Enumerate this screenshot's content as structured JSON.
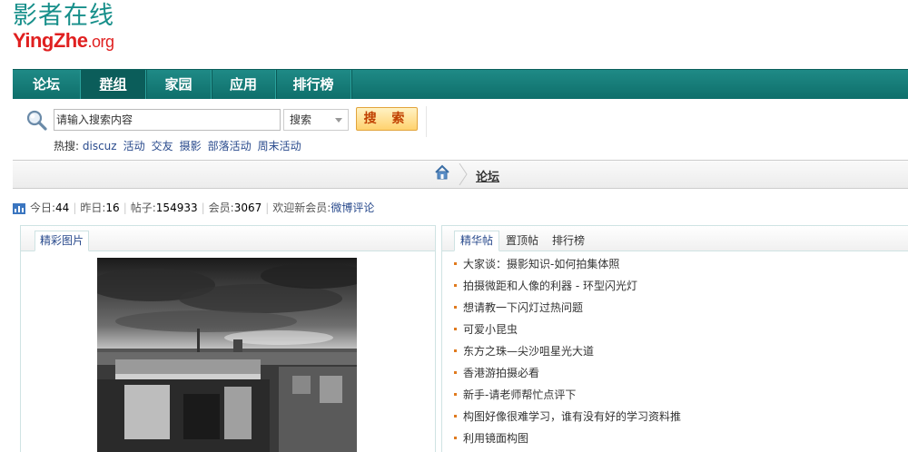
{
  "logo": {
    "cn": "影者在线",
    "en": "YingZhe",
    "en_suffix": ".org"
  },
  "nav": {
    "items": [
      "论坛",
      "群组",
      "家园",
      "应用",
      "排行榜"
    ],
    "active_index": 1
  },
  "search": {
    "placeholder": "请输入搜索内容",
    "type_selected": "搜索",
    "button_label": "搜 索",
    "hot_label": "热搜:",
    "hot_terms": [
      "discuz",
      "活动",
      "交友",
      "摄影",
      "部落活动",
      "周末活动"
    ]
  },
  "breadcrumb": {
    "current": "论坛"
  },
  "stats": {
    "today_label": "今日:",
    "today_value": "44",
    "yesterday_label": "昨日:",
    "yesterday_value": "16",
    "posts_label": "帖子:",
    "posts_value": "154933",
    "members_label": "会员:",
    "members_value": "3067",
    "welcome_label": "欢迎新会员:",
    "new_member": "微博评论"
  },
  "left_panel": {
    "tab": "精彩图片"
  },
  "right_panel": {
    "tabs": [
      "精华帖",
      "置顶帖",
      "排行榜"
    ],
    "active_tab": 0,
    "threads": [
      "大家谈：摄影知识-如何拍集体照",
      "拍摄微距和人像的利器 - 环型闪光灯",
      "想请教一下闪灯过热问题",
      "可爱小昆虫",
      "东方之珠—尖沙咀星光大道",
      "香港游拍摄必看",
      "新手-请老师帮忙点评下",
      "构图好像很难学习，谁有没有好的学习资料推",
      "利用镜面构图"
    ]
  },
  "colors": {
    "brand_teal": "#178f8a",
    "brand_red": "#e02020",
    "nav_bg": "#0e6e6a",
    "link": "#2a4b8d",
    "bullet": "#e07a1e"
  }
}
